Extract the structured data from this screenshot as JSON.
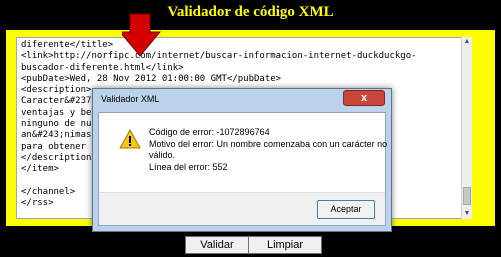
{
  "app": {
    "title": "Validador de código XML"
  },
  "editor": {
    "lines": [
      "diferente</title>",
      "<link>http://norfipc.com/internet/buscar-informacion-internet-duckduckgo-",
      "buscador-diferente.html</link>",
      "<pubDate>Wed, 28 Nov 2012 01:00:00 GMT</pubDate>",
      "<description>",
      "Caracter&#237;sticas diferenciales de DuckDuckGo son sus mejores,",
      "ventajas y beneficios que ofrece un sitio rastreado y no rastreados",
      "ninguno de nuestras búsquedas, lo que sería actualmente",
      "an&#243;nimas y elemento",
      "para obtener",
      "</description>",
      "</item>",
      "",
      "</channel>",
      "</rss>"
    ]
  },
  "buttons": {
    "validate": "Validar",
    "clear": "Limpiar"
  },
  "dialog": {
    "title": "Validador XML",
    "close": "x",
    "error_code": "Código de error: -1072896764",
    "error_reason_1": "Motivo del error: Un nombre comenzaba con un carácter no",
    "error_reason_2": "válido.",
    "error_line": "Línea del error: 552",
    "ok": "Aceptar"
  },
  "colors": {
    "title": "#ffff00",
    "frame": "#ffff00",
    "arrow": "#d40000"
  }
}
